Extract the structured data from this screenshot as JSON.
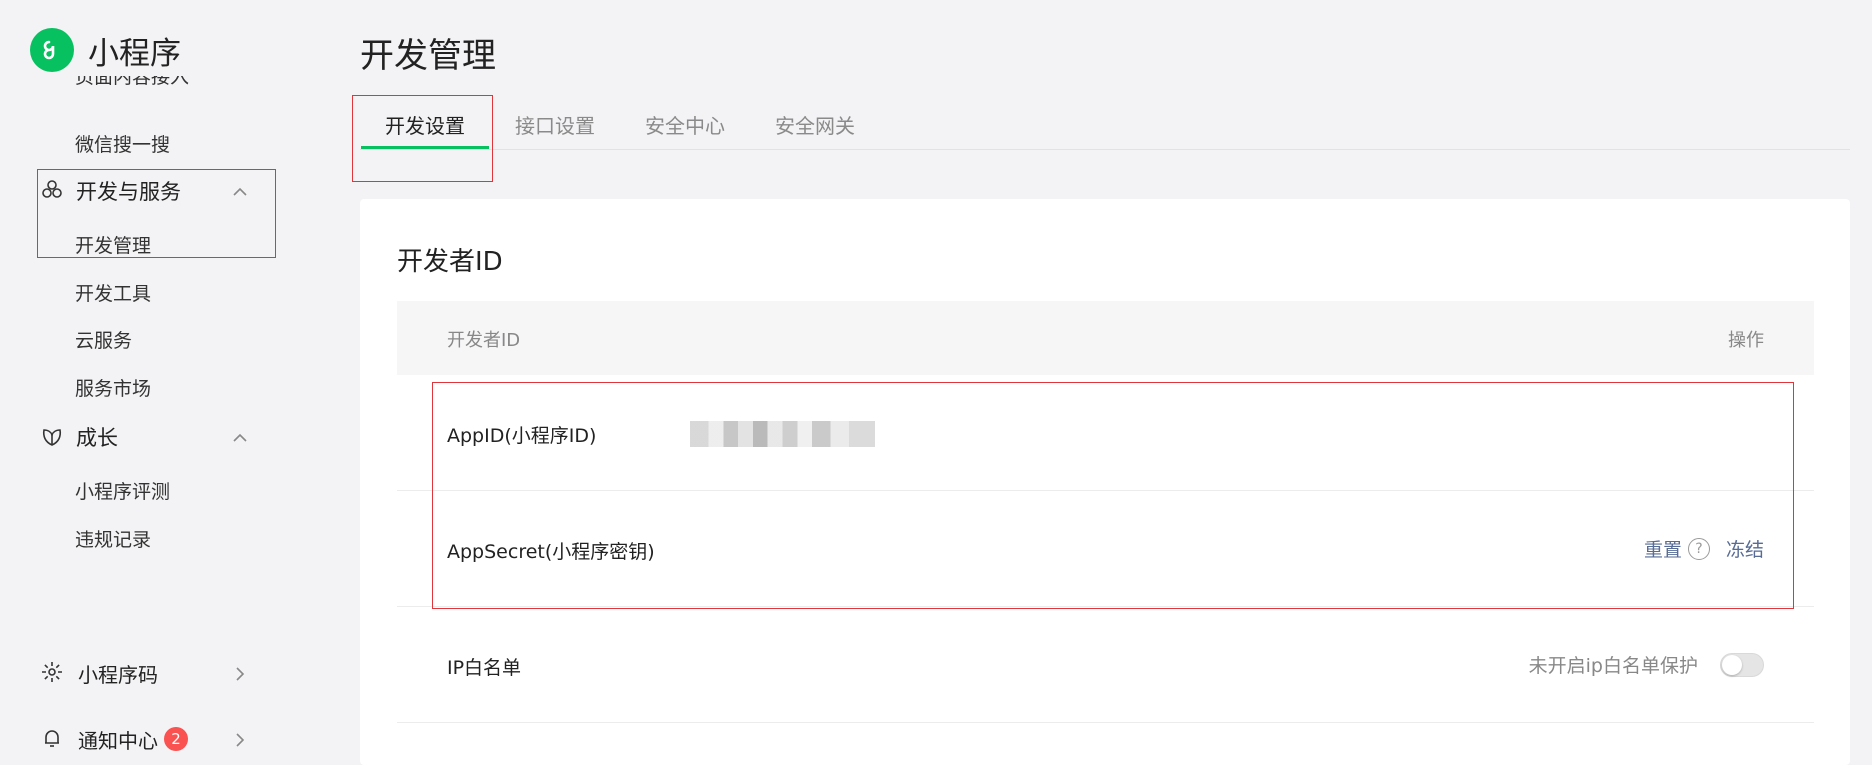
{
  "brand": {
    "name": "小程序",
    "color": "#07c160"
  },
  "sidebar": {
    "clipped_item": "页面内容接入",
    "wechat_search": "微信搜一搜",
    "dev_services": {
      "label": "开发与服务",
      "items": [
        "开发管理",
        "开发工具",
        "云服务",
        "服务市场"
      ]
    },
    "growth": {
      "label": "成长",
      "items": [
        "小程序评测",
        "违规记录"
      ]
    },
    "qrcode": {
      "label": "小程序码"
    },
    "notifications": {
      "label": "通知中心",
      "badge": "2"
    }
  },
  "main": {
    "title": "开发管理",
    "tabs": [
      "开发设置",
      "接口设置",
      "安全中心",
      "安全网关"
    ],
    "active_tab": 0,
    "card": {
      "title": "开发者ID",
      "headers": {
        "col1": "开发者ID",
        "col2": "操作"
      },
      "rows": {
        "appid": {
          "label": "AppID(小程序ID)"
        },
        "appsecret": {
          "label": "AppSecret(小程序密钥)",
          "reset": "重置",
          "help": "?",
          "freeze": "冻结"
        },
        "ip": {
          "label": "IP白名单",
          "status": "未开启ip白名单保护",
          "enabled": false
        }
      }
    }
  },
  "colors": {
    "accent": "#07c160",
    "link": "#576b95",
    "badge": "#fa5151",
    "highlight": "#e0353a"
  }
}
